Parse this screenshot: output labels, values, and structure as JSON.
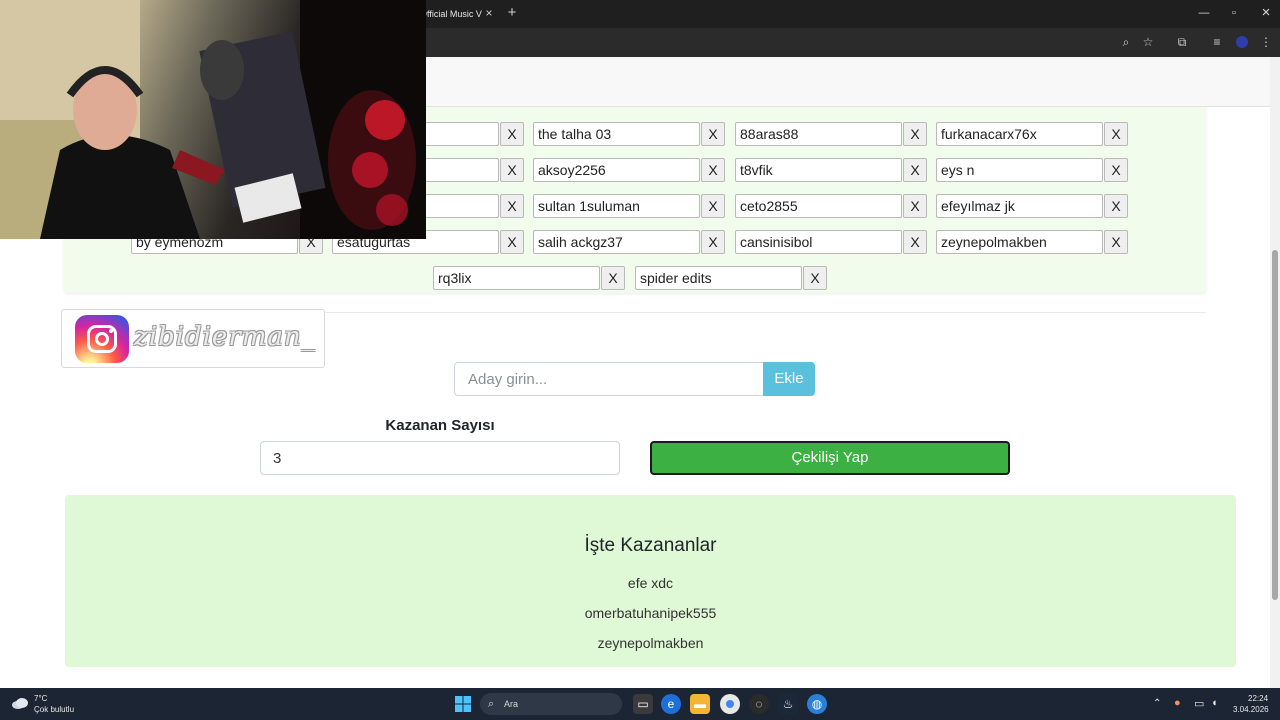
{
  "browser": {
    "tab_title": "Official Music V",
    "tab_close": "×",
    "new_tab": "+",
    "minimize": "—",
    "maximize": "▫",
    "close": "×"
  },
  "candidates": {
    "remove_label": "X",
    "rows": [
      [
        "",
        "the talha 03",
        "88aras88",
        "furkanacarx76x"
      ],
      [
        "",
        "aksoy2256",
        "t8vfik",
        "eys n"
      ],
      [
        "",
        "sultan 1suluman",
        "ceto2855",
        "efeyılmaz jk"
      ],
      [
        "by eymenozm",
        "esatugurtas",
        "salih ackgz37",
        "cansinisibol",
        "zeynepolmakben"
      ],
      [
        "rq3lix",
        "spider edits"
      ]
    ]
  },
  "instagram": {
    "handle": "zibidierman_"
  },
  "add_candidate": {
    "placeholder": "Aday girin...",
    "button_label": "Ekle"
  },
  "draw": {
    "winner_count_label": "Kazanan Sayısı",
    "winner_count_value": "3",
    "button_label": "Çekilişi Yap"
  },
  "results": {
    "title": "İşte Kazananlar",
    "winners": [
      "efe xdc",
      "omerbatuhanipek555",
      "zeynepolmakben"
    ]
  },
  "taskbar": {
    "temperature": "7°C",
    "weather": "Çok bulutlu",
    "search_label": "Ara",
    "time": "22:24",
    "date": "3.04.2026"
  },
  "colors": {
    "candidate_panel": "#f1fcec",
    "add_button": "#5bc0de",
    "draw_button": "#3cb043",
    "results_panel": "#dff8d5"
  }
}
